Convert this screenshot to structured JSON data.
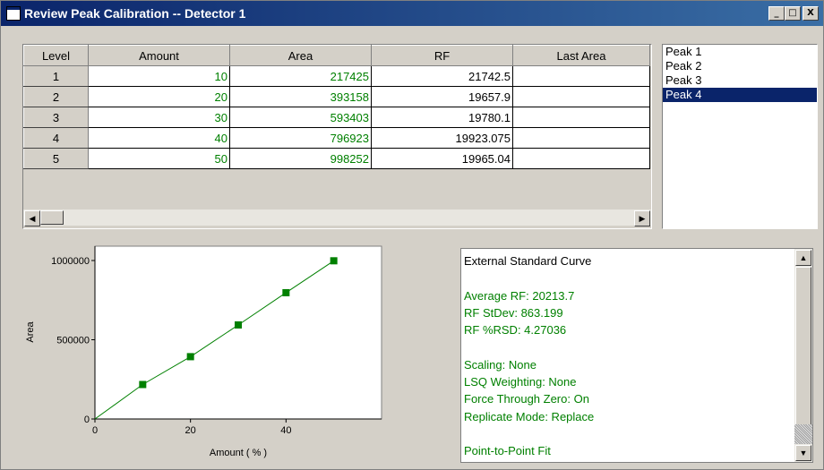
{
  "window": {
    "title": "Review Peak Calibration -- Detector 1",
    "controls": {
      "minimize": "_",
      "maximize": "□",
      "close": "X"
    }
  },
  "table": {
    "headers": [
      "Level",
      "Amount",
      "Area",
      "RF",
      "Last Area"
    ],
    "rows": [
      {
        "level": "1",
        "amount": "10",
        "area": "217425",
        "rf": "21742.5",
        "last_area": ""
      },
      {
        "level": "2",
        "amount": "20",
        "area": "393158",
        "rf": "19657.9",
        "last_area": ""
      },
      {
        "level": "3",
        "amount": "30",
        "area": "593403",
        "rf": "19780.1",
        "last_area": ""
      },
      {
        "level": "4",
        "amount": "40",
        "area": "796923",
        "rf": "19923.075",
        "last_area": ""
      },
      {
        "level": "5",
        "amount": "50",
        "area": "998252",
        "rf": "19965.04",
        "last_area": ""
      }
    ]
  },
  "peaks": {
    "items": [
      "Peak 1",
      "Peak 2",
      "Peak 3",
      "Peak 4"
    ],
    "selected": "Peak 4"
  },
  "chart_data": {
    "type": "line",
    "x": [
      0,
      10,
      20,
      30,
      40,
      50
    ],
    "y": [
      0,
      217425,
      393158,
      593403,
      796923,
      998252
    ],
    "xlabel": "Amount ( % )",
    "ylabel": "Area",
    "xlim": [
      0,
      60
    ],
    "ylim": [
      0,
      1000000
    ],
    "xticks": [
      0,
      20,
      40
    ],
    "yticks": [
      0,
      500000,
      1000000
    ],
    "color": "#008000",
    "marker_color": "#008000",
    "grid": false
  },
  "info": {
    "title": "External Standard Curve",
    "lines": [
      "",
      "Average RF: 20213.7",
      "RF StDev: 863.199",
      "RF %RSD: 4.27036",
      "",
      "Scaling: None",
      "LSQ Weighting: None",
      "Force Through Zero: On",
      "Replicate Mode: Replace",
      "",
      "Point-to-Point Fit"
    ]
  },
  "icons": [
    "window-icon",
    "minimize-icon",
    "maximize-icon",
    "close-icon",
    "scroll-left-icon",
    "scroll-right-icon",
    "scroll-up-icon",
    "scroll-down-icon"
  ]
}
